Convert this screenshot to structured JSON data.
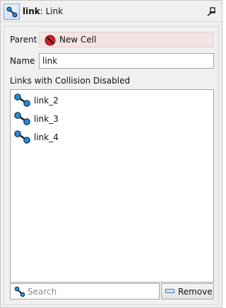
{
  "header": {
    "title_bold": "link",
    "title_rest": ": Link",
    "link_icon": "link-icon",
    "pin_icon": "pin-icon"
  },
  "form": {
    "parent_label": "Parent",
    "parent_value": "New Cell",
    "parent_icon": "no-entry-icon",
    "name_label": "Name",
    "name_value": "link"
  },
  "links_section": {
    "title": "Links with Collision Disabled",
    "items": [
      {
        "label": "link_2",
        "icon": "link-icon"
      },
      {
        "label": "link_3",
        "icon": "link-icon"
      },
      {
        "label": "link_4",
        "icon": "link-icon"
      }
    ]
  },
  "footer": {
    "search_placeholder": "Search",
    "remove_label": "Remove"
  },
  "colors": {
    "parent_bg": "#f3e4e4",
    "link_blue": "#1e8ee0",
    "link_dark": "#1b2a3a",
    "no_entry_red": "#d32020"
  }
}
